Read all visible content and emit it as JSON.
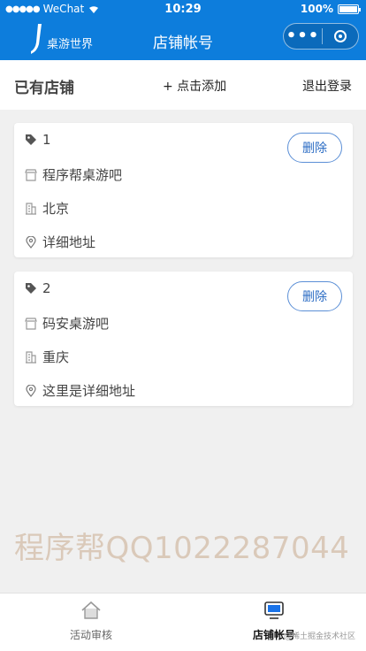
{
  "status_bar": {
    "carrier": "WeChat",
    "time": "10:29",
    "battery": "100%"
  },
  "nav": {
    "logo_text": "桌游世界",
    "title": "店铺帐号",
    "more_icon": "more-dots-icon",
    "close_icon": "target-close-icon"
  },
  "header": {
    "title": "已有店铺",
    "add_label": "+ 点击添加",
    "logout_label": "退出登录"
  },
  "stores": [
    {
      "id": "1",
      "name": "程序帮桌游吧",
      "city": "北京",
      "address": "详细地址",
      "delete_label": "删除"
    },
    {
      "id": "2",
      "name": "码安桌游吧",
      "city": "重庆",
      "address": "这里是详细地址",
      "delete_label": "删除"
    }
  ],
  "watermark": "程序帮QQ1022287044",
  "tabbar": {
    "tabs": [
      {
        "label": "活动审核",
        "icon": "home-icon",
        "active": false
      },
      {
        "label": "店铺帐号",
        "icon": "monitor-icon",
        "active": true
      }
    ]
  },
  "credit": "@稀土掘金技术社区",
  "colors": {
    "brand": "#0d7ddc",
    "button_border": "#5b8fd6",
    "button_text": "#2b6cc4"
  }
}
